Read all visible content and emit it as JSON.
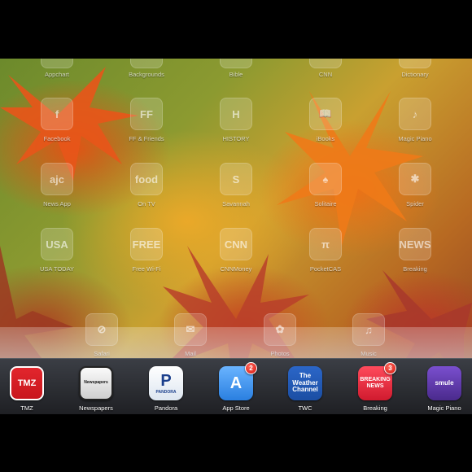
{
  "top_row_labels": [
    "Appchart",
    "Backgrounds",
    "Bible",
    "CNN",
    "Dictionary"
  ],
  "grid_rows": [
    [
      {
        "label": "Facebook",
        "glyph": "f"
      },
      {
        "label": "FF & Friends",
        "glyph": "FF"
      },
      {
        "label": "HISTORY",
        "glyph": "H"
      },
      {
        "label": "iBooks",
        "glyph": "📖"
      },
      {
        "label": "Magic Piano",
        "glyph": "♪"
      }
    ],
    [
      {
        "label": "News App",
        "glyph": "ajc"
      },
      {
        "label": "On TV",
        "glyph": "food"
      },
      {
        "label": "Savannah",
        "glyph": "S"
      },
      {
        "label": "Solitaire",
        "glyph": "♠"
      },
      {
        "label": "Spider",
        "glyph": "✱"
      }
    ],
    [
      {
        "label": "USA TODAY",
        "glyph": "USA"
      },
      {
        "label": "Free Wi-Fi",
        "glyph": "FREE"
      },
      {
        "label": "CNNMoney",
        "glyph": "CNN"
      },
      {
        "label": "PocketCAS",
        "glyph": "π"
      },
      {
        "label": "Breaking",
        "glyph": "NEWS"
      }
    ]
  ],
  "shelf_apps": [
    {
      "label": "Safari",
      "glyph": "⊘"
    },
    {
      "label": "Mail",
      "glyph": "✉"
    },
    {
      "label": "Photos",
      "glyph": "✿"
    },
    {
      "label": "Music",
      "glyph": "♫"
    }
  ],
  "dock": [
    {
      "label": "TMZ",
      "icon_text": "TMZ",
      "badge": ""
    },
    {
      "label": "Newspapers",
      "icon_text": "Newspapers",
      "badge": ""
    },
    {
      "label": "Pandora",
      "icon_text": "P",
      "icon_subtext": "PANDORA",
      "badge": ""
    },
    {
      "label": "App Store",
      "icon_text": "A",
      "badge": "2"
    },
    {
      "label": "TWC",
      "icon_text": "The Weather Channel",
      "badge": ""
    },
    {
      "label": "Breaking",
      "icon_text": "BREAKING NEWS",
      "badge": "3"
    },
    {
      "label": "Magic Piano",
      "icon_text": "smule",
      "badge": ""
    }
  ],
  "colors": {
    "tmz": "#c8161d",
    "appstore": "#2a7fe0",
    "twc": "#1b4ea3",
    "breaking": "#d01a2e",
    "magic_piano": "#4a2a8c"
  }
}
